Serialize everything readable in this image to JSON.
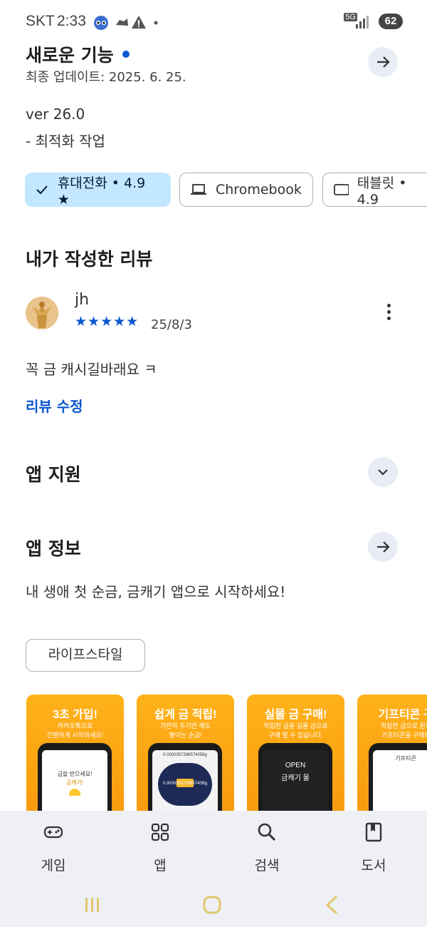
{
  "status_bar": {
    "carrier": "SKT",
    "time": "2:33",
    "network": "5G",
    "battery": "62"
  },
  "whats_new": {
    "title": "새로운 기능",
    "updated": "최종 업데이트: 2025. 6. 25.",
    "version": "ver 26.0",
    "note": "- 최적화 작업"
  },
  "device_chips": [
    {
      "label": "휴대전화 • 4.9 ★",
      "selected": true
    },
    {
      "label": "Chromebook",
      "selected": false
    },
    {
      "label": "태블릿 • 4.9",
      "selected": false
    }
  ],
  "my_review": {
    "title": "내가 작성한 리뷰",
    "reviewer": "jh",
    "stars": "★★★★★",
    "rating": 5,
    "date": "25/8/3",
    "text": "꼭 금 캐시길바래요 ㅋ",
    "edit_label": "리뷰 수정"
  },
  "app_support": {
    "title": "앱 지원"
  },
  "app_info": {
    "title": "앱 정보",
    "description": "내 생애 첫 순금, 금캐기 앱으로 시작하세요!",
    "tag": "라이프스타일"
  },
  "screenshots": [
    {
      "title": "3초 가입!",
      "subtitle1": "카카오톡으로",
      "subtitle2": "간편하게 시작하세요!",
      "screen_text1": "금을 받으세요!",
      "screen_text2": "금캐기!"
    },
    {
      "title": "쉽게 금 적립!",
      "subtitle1": "가만히 두기만 해도",
      "subtitle2": "쌓이는 순금!",
      "screen_text1": "0.0000357286574058g",
      "screen_text2": "0.000035372865740Bg"
    },
    {
      "title": "실물 금 구매!",
      "subtitle1": "적립한 금을 실물 금으로",
      "subtitle2": "구매 할 수 있습니다.",
      "screen_text1": "OPEN",
      "screen_text2": "금캐기 몰"
    },
    {
      "title": "기프티콘 구",
      "subtitle1": "적립한 금으로 원하",
      "subtitle2": "기프티콘을 구매하",
      "screen_text1": "기프티콘",
      "screen_text2": ""
    }
  ],
  "bottom_nav": [
    {
      "label": "게임",
      "icon": "gamepad-icon"
    },
    {
      "label": "앱",
      "icon": "apps-grid-icon"
    },
    {
      "label": "검색",
      "icon": "search-icon"
    },
    {
      "label": "도서",
      "icon": "book-icon"
    }
  ],
  "colors": {
    "accent": "#0b57d0",
    "chip_selected": "#c2e7ff",
    "nav_bg": "#eef0f6",
    "screenshot_orange": "#f7960c"
  }
}
